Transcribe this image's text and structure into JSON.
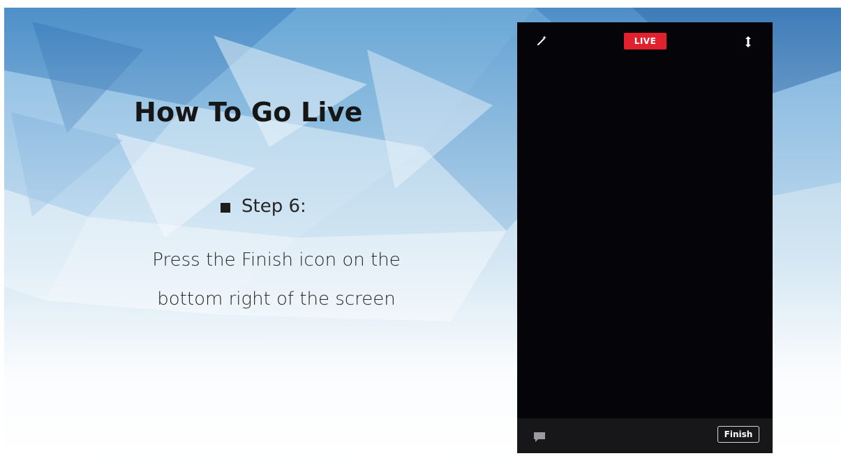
{
  "slide": {
    "title": "How To Go Live",
    "step_label": "Step 6:",
    "instruction": "Press the Finish icon on the bottom right of the screen"
  },
  "phone": {
    "live_badge": "LIVE",
    "finish_button": "Finish",
    "icons": {
      "top_left": "magic-wand-icon",
      "top_right": "camera-flip-icon",
      "bottom_left": "comment-icon"
    },
    "colors": {
      "live_badge": "#e0222e",
      "screen": "#050409",
      "bottom_bar": "#17171a"
    }
  }
}
